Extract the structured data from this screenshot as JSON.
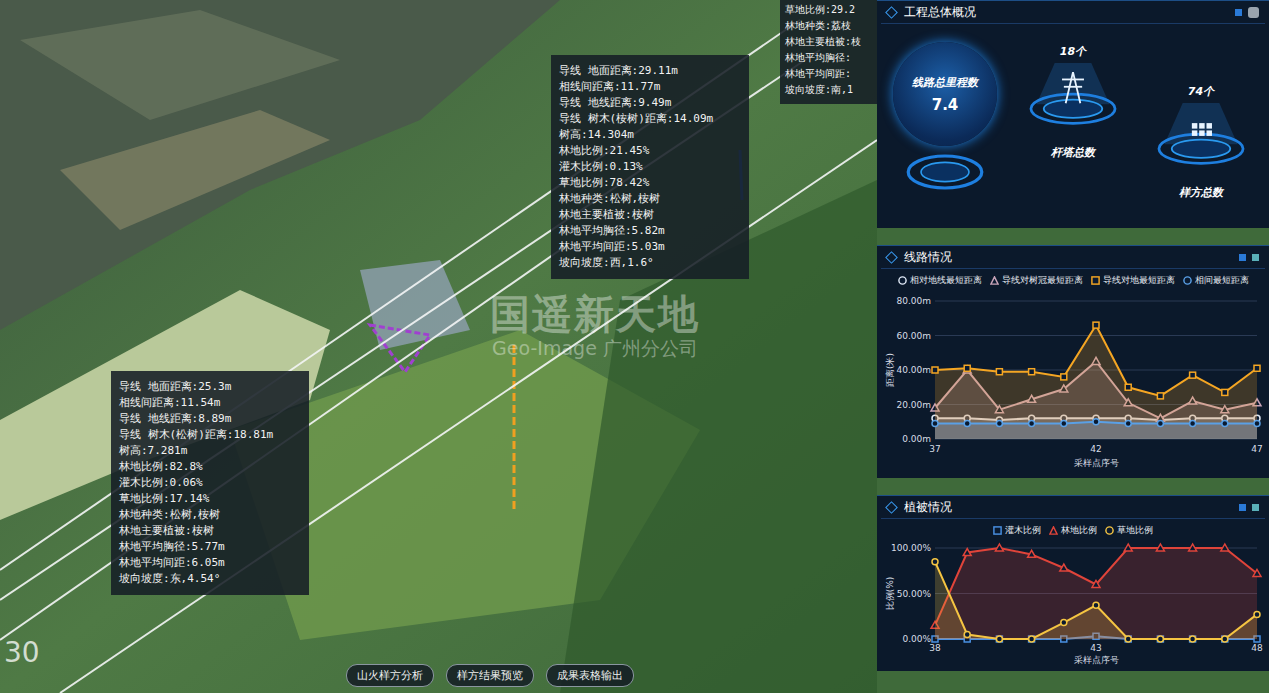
{
  "tooltips": [
    {
      "lines": [
        "导线 地面距离:29.11m",
        "相线间距离:11.77m",
        "导线 地线距离:9.49m",
        "导线 树木(桉树)距离:14.09m",
        "树高:14.304m",
        "林地比例:21.45%",
        "灌木比例:0.13%",
        "草地比例:78.42%",
        "林地种类:松树,桉树",
        "林地主要植被:桉树",
        "林地平均胸径:5.82m",
        "林地平均间距:5.03m",
        "坡向坡度:西,1.6°"
      ]
    },
    {
      "lines": [
        "导线 地面距离:25.3m",
        "相线间距离:11.54m",
        "导线 地线距离:8.89m",
        "导线 树木(松树)距离:18.81m",
        "树高:7.281m",
        "林地比例:82.8%",
        "灌木比例:0.06%",
        "草地比例:17.14%",
        "林地种类:松树,桉树",
        "林地主要植被:桉树",
        "林地平均胸径:5.77m",
        "林地平均间距:6.05m",
        "坡向坡度:东,4.54°"
      ]
    },
    {
      "lines": [
        "草地比例:29.2",
        "林地种类:荔枝",
        "林地主要植被:枝",
        "林地平均胸径:",
        "林地平均间距:",
        "坡向坡度:南,1"
      ]
    }
  ],
  "watermark": {
    "title": "国遥新天地",
    "subtitle": "Geo-Image 广州分公司"
  },
  "corner_label": "30",
  "toolbar": {
    "buttons": [
      "山火样方分析",
      "样方结果预览",
      "成果表格输出"
    ]
  },
  "overview": {
    "title": "工程总体概况",
    "stats": [
      {
        "label": "线路总里程数",
        "value": "7.4",
        "kind": "globe"
      },
      {
        "label": "杆塔总数",
        "value": "18个",
        "kind": "tower"
      },
      {
        "label": "样方总数",
        "value": "74个",
        "kind": "grid"
      }
    ]
  },
  "line_chart": {
    "title": "线路情况",
    "y_title": "距离(米)",
    "x_title": "采样点序号",
    "y_ticks": [
      "80.00m",
      "60.00m",
      "40.00m",
      "20.00m",
      "0.00m"
    ],
    "x_ticks": [
      "37",
      "42",
      "47"
    ],
    "series": [
      {
        "name": "相对地线最短距离",
        "kind": "circle",
        "color": "#dfe8f5",
        "values": [
          12,
          12,
          11,
          12,
          12,
          12,
          12,
          11,
          12,
          12,
          12
        ]
      },
      {
        "name": "导线对树冠最短距离",
        "kind": "triangle",
        "color": "#c9a4b8",
        "values": [
          18,
          40,
          17,
          23,
          29,
          45,
          21,
          12,
          22,
          17,
          21
        ]
      },
      {
        "name": "导线对地最短距离",
        "kind": "square",
        "color": "#f5a623",
        "values": [
          40,
          41,
          39,
          39,
          36,
          66,
          30,
          25,
          37,
          27,
          41
        ]
      },
      {
        "name": "相间最短距离",
        "kind": "circle",
        "color": "#5aa0e6",
        "values": [
          9,
          9,
          9,
          9,
          9,
          10,
          9,
          9,
          9,
          9,
          9
        ]
      }
    ]
  },
  "vegetation_chart": {
    "title": "植被情况",
    "y_title": "比例(%)",
    "x_title": "采样点序号",
    "y_ticks": [
      "100.00%",
      "50.00%",
      "0.00%"
    ],
    "x_ticks": [
      "38",
      "43",
      "48"
    ],
    "series": [
      {
        "name": "灌木比例",
        "kind": "square",
        "color": "#4a90e2",
        "values": [
          0,
          0,
          0,
          0,
          0,
          3,
          0,
          0,
          0,
          0,
          0
        ]
      },
      {
        "name": "林地比例",
        "kind": "triangle",
        "color": "#e0443a",
        "values": [
          15,
          95,
          100,
          93,
          78,
          60,
          100,
          100,
          100,
          100,
          72
        ]
      },
      {
        "name": "草地比例",
        "kind": "circle",
        "color": "#f5c542",
        "values": [
          85,
          5,
          0,
          0,
          18,
          37,
          0,
          0,
          0,
          0,
          27
        ]
      }
    ]
  }
}
